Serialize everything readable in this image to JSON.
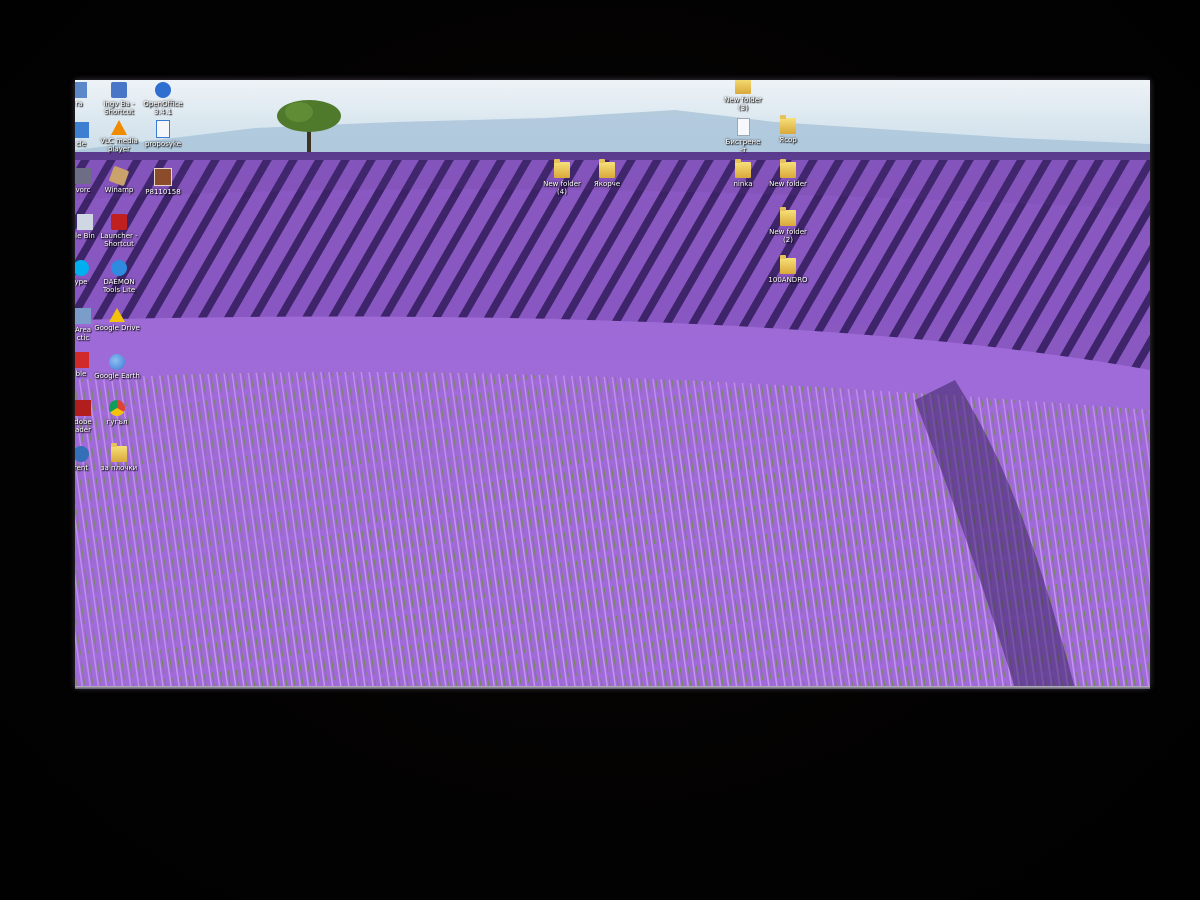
{
  "desktop": {
    "icons_left": [
      {
        "label": "ingv Ba -\nShortcut",
        "icon": "shortcut-icon",
        "color": "#4a76c8"
      },
      {
        "label": "OpenOffice\n3.4.1",
        "icon": "openoffice-icon",
        "color": "#2e6fd0"
      },
      {
        "label": "VLC media\nplayer",
        "icon": "vlc-icon",
        "color": "#f08a00"
      },
      {
        "label": "proposyke",
        "icon": "document-icon",
        "color": "#3b7bd6"
      },
      {
        "label": "Winamp",
        "icon": "winamp-icon",
        "color": "#c9a36b"
      },
      {
        "label": "P8110158",
        "icon": "photo-icon",
        "color": "#8a4c2b"
      },
      {
        "label": "Launcher -\nShortcut",
        "icon": "launcher-icon",
        "color": "#c02020"
      },
      {
        "label": "DAEMON\nTools Lite",
        "icon": "daemon-icon",
        "color": "#2f8be0"
      },
      {
        "label": "Google Drive",
        "icon": "google-drive-icon",
        "color": "#f4c20d"
      },
      {
        "label": "Google Earth",
        "icon": "google-earth-icon",
        "color": "#3a78d8"
      },
      {
        "label": "гугъл",
        "icon": "chrome-icon",
        "color": "#db4437"
      },
      {
        "label": "за плочки",
        "icon": "folder-icon",
        "color": "#e8c35a"
      }
    ],
    "icons_edge": [
      {
        "label": "ra",
        "icon": "partial-icon"
      },
      {
        "label": "cle",
        "icon": "partial-icon"
      },
      {
        "label": "vorc",
        "icon": "partial-icon"
      },
      {
        "label": "le Bin",
        "icon": "recycle-bin-icon"
      },
      {
        "label": "ype",
        "icon": "skype-icon"
      },
      {
        "label": "Area\nctic",
        "icon": "partial-icon"
      },
      {
        "label": "ble",
        "icon": "partial-icon"
      },
      {
        "label": "dobe\nader",
        "icon": "partial-icon"
      },
      {
        "label": "rent",
        "icon": "partial-icon"
      }
    ],
    "icons_center": [
      {
        "label": "New folder\n(4)",
        "icon": "folder-icon"
      },
      {
        "label": "Якорче",
        "icon": "folder-icon"
      }
    ],
    "icons_right": [
      {
        "label": "New folder\n(3)",
        "icon": "folder-icon"
      },
      {
        "label": "Бистрене\n-т",
        "icon": "document-icon"
      },
      {
        "label": "Ясор",
        "icon": "folder-icon"
      },
      {
        "label": "ninka",
        "icon": "folder-icon"
      },
      {
        "label": "New folder",
        "icon": "folder-icon"
      },
      {
        "label": "New folder\n(2)",
        "icon": "folder-icon"
      },
      {
        "label": "100ANDRO",
        "icon": "folder-icon"
      }
    ]
  },
  "colors": {
    "sky": "#dfeaf3",
    "lavender": "#8f5fc4",
    "lavender_dark": "#3f2468",
    "grass": "#6f8a3a"
  }
}
